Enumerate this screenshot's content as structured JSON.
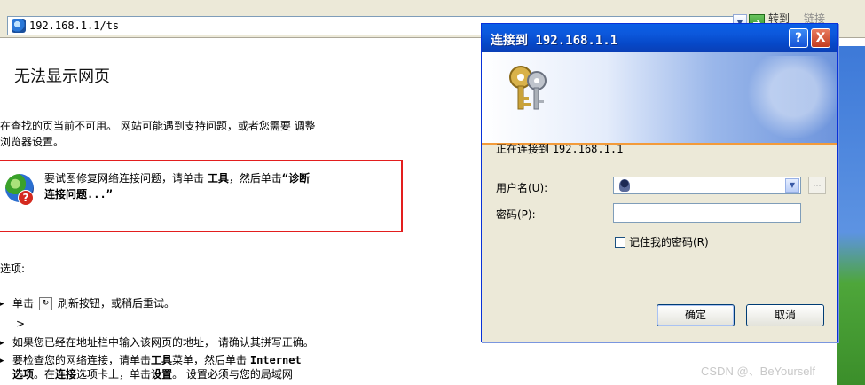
{
  "browser": {
    "address": "192.168.1.1/ts",
    "go_label": "转到",
    "links_label": "链接"
  },
  "error_page": {
    "title": "无法显示网页",
    "para_line1": "在查找的页当前不可用。 网站可能遇到支持问题，或者您需要 调整",
    "para_line2": "浏览器设置。",
    "tip_pre": "要试图修复网络连接问题，请单击 ",
    "tip_tools": "工具",
    "tip_mid": "，然后单击",
    "tip_diag1": "“诊断",
    "tip_diag2": "连接问题...”",
    "options_label": "选项:",
    "opt1_pre": "单击",
    "opt1_post": "刷新按钮，或稍后重试。",
    "chevron": ">",
    "opt2": "如果您已经在地址栏中输入该网页的地址， 请确认其拼写正确。",
    "opt3_pre": "要检查您的网络连接，请单击",
    "opt3_tools": "工具",
    "opt3_mid": "菜单，然后单击 ",
    "opt3_internet": "Internet",
    "opt4_options": "选项",
    "opt4_mid": "。在",
    "opt4_conn": "连接",
    "opt4_mid2": "选项卡上，单击",
    "opt4_settings": "设置",
    "opt4_post": "。 设置必须与您的局域网"
  },
  "dialog": {
    "title": "连接到 192.168.1.1",
    "help_glyph": "?",
    "close_glyph": "X",
    "connecting_label": "正在连接到 ",
    "connecting_host": "192.168.1.1",
    "username_label": "用户名(U):",
    "password_label": "密码(P):",
    "username_value": "",
    "password_value": "",
    "remember_label": "记住我的密码(R)",
    "remember_checked": false,
    "ok_label": "确定",
    "cancel_label": "取消"
  },
  "watermark": "CSDN @、BeYourself",
  "colors": {
    "titlebar": "#0a5fe6",
    "highlight_box": "#e31e1e",
    "dialog_bg": "#ece9d8"
  }
}
